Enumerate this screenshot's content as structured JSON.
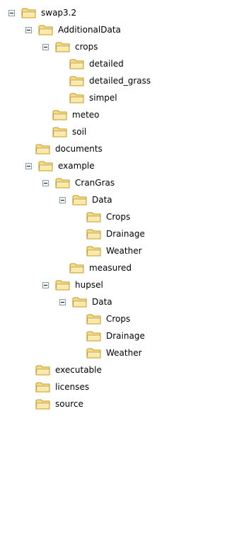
{
  "tree": {
    "nodes": [
      {
        "label": "swap3.2",
        "icon": "folder-icon",
        "toggle": "minus"
      },
      {
        "label": "AdditionalData",
        "icon": "folder-icon",
        "toggle": "minus"
      },
      {
        "label": "crops",
        "icon": "folder-icon",
        "toggle": "minus"
      },
      {
        "label": "detailed",
        "icon": "folder-icon",
        "toggle": "none"
      },
      {
        "label": "detailed_grass",
        "icon": "folder-icon",
        "toggle": "none"
      },
      {
        "label": "simpel",
        "icon": "folder-icon",
        "toggle": "none"
      },
      {
        "label": "meteo",
        "icon": "folder-icon",
        "toggle": "none"
      },
      {
        "label": "soil",
        "icon": "folder-icon",
        "toggle": "none"
      },
      {
        "label": "documents",
        "icon": "folder-icon",
        "toggle": "none"
      },
      {
        "label": "example",
        "icon": "folder-icon",
        "toggle": "minus"
      },
      {
        "label": "CranGras",
        "icon": "folder-icon",
        "toggle": "minus"
      },
      {
        "label": "Data",
        "icon": "folder-icon",
        "toggle": "minus"
      },
      {
        "label": "Crops",
        "icon": "folder-icon",
        "toggle": "none"
      },
      {
        "label": "Drainage",
        "icon": "folder-icon",
        "toggle": "none"
      },
      {
        "label": "Weather",
        "icon": "folder-icon",
        "toggle": "none"
      },
      {
        "label": "measured",
        "icon": "folder-icon",
        "toggle": "none"
      },
      {
        "label": "hupsel",
        "icon": "folder-icon",
        "toggle": "minus"
      },
      {
        "label": "Data",
        "icon": "folder-icon",
        "toggle": "minus"
      },
      {
        "label": "Crops",
        "icon": "folder-icon",
        "toggle": "none"
      },
      {
        "label": "Drainage",
        "icon": "folder-icon",
        "toggle": "none"
      },
      {
        "label": "Weather",
        "icon": "folder-icon",
        "toggle": "none"
      },
      {
        "label": "executable",
        "icon": "folder-icon",
        "toggle": "none"
      },
      {
        "label": "licenses",
        "icon": "folder-icon",
        "toggle": "none"
      },
      {
        "label": "source",
        "icon": "folder-icon",
        "toggle": "none"
      }
    ]
  },
  "colors": {
    "folder_fill": "#f7dc85",
    "folder_front": "#fbe9a7",
    "folder_outline": "#c39a2f",
    "toggle_border": "#7f9db9"
  }
}
